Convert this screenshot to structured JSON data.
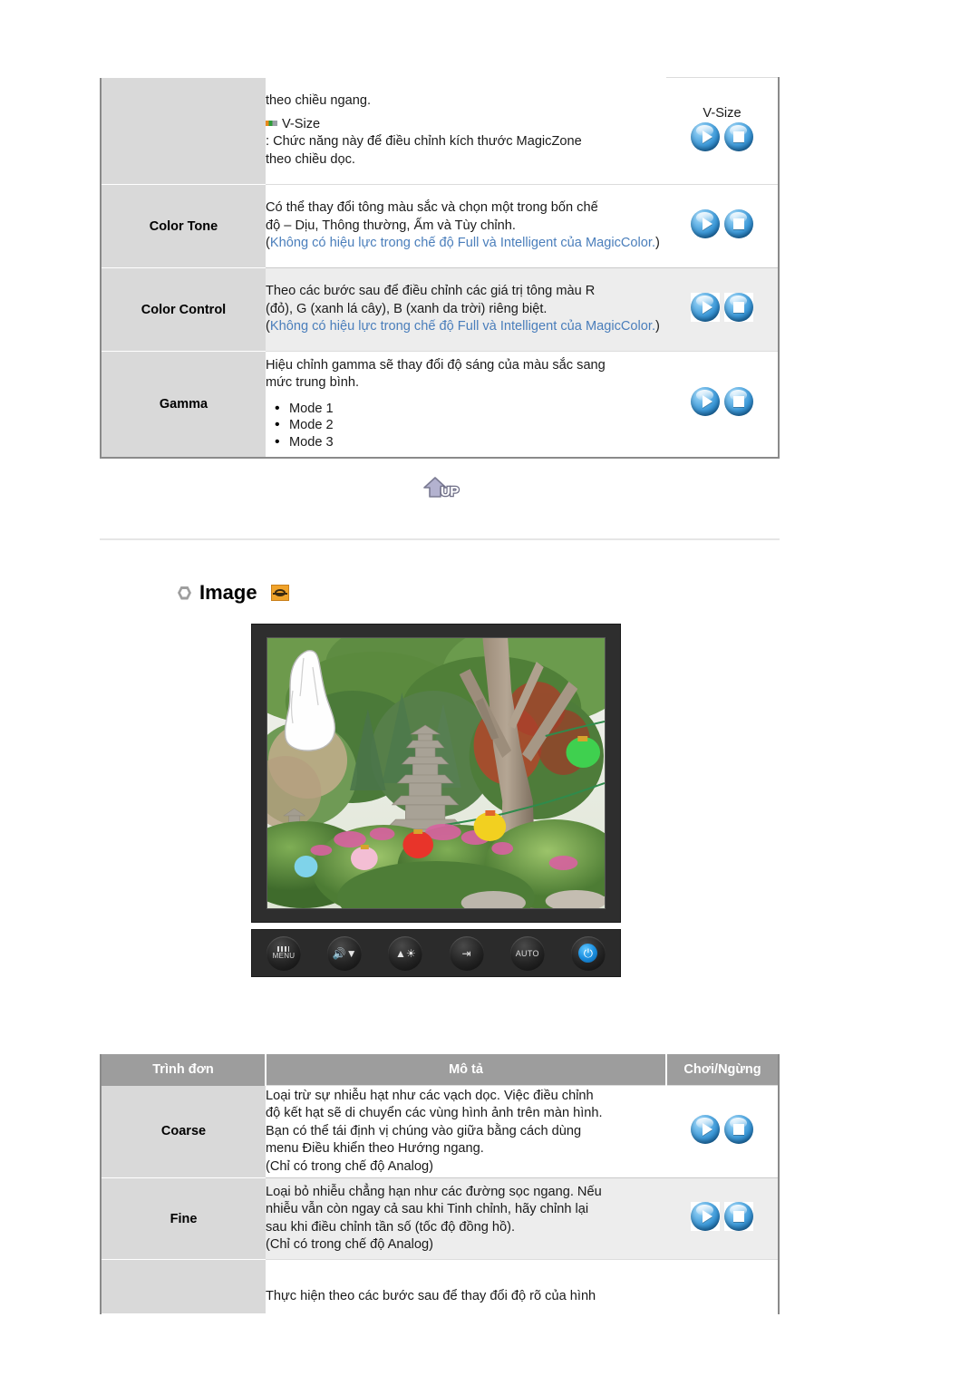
{
  "top_table": {
    "rows": [
      {
        "menu": "",
        "desc_lines": [
          "theo chiều ngang.",
          "V-Size",
          ": Chức năng này để điều chỉnh kích thước MagicZone",
          "theo chiều dọc."
        ],
        "play_label": "V-Size",
        "shade": "white"
      },
      {
        "menu": "Color Tone",
        "desc_lines": [
          "Có thể thay đổi tông màu sắc và chọn một trong bốn chế",
          "độ – Dịu, Thông thường, Ấm và Tùy chỉnh."
        ],
        "note_open": "(",
        "note_blue": "Không có hiệu lực trong chế độ Full và Intelligent của MagicColor.",
        "note_close": ")",
        "play_label": "",
        "shade": "white"
      },
      {
        "menu": "Color Control",
        "desc_lines": [
          "Theo các bước sau để điều chỉnh các giá trị tông màu R",
          "(đỏ), G (xanh lá cây), B (xanh da trời) riêng biệt."
        ],
        "note_open": "(",
        "note_blue": "Không có hiệu lực trong chế độ Full và Intelligent của MagicColor.",
        "note_close": ")",
        "play_label": "",
        "shade": "gray"
      },
      {
        "menu": "Gamma",
        "desc_lines": [
          "Hiệu chỉnh gamma sẽ thay đổi độ sáng của màu sắc sang",
          "mức trung bình."
        ],
        "modes": [
          "Mode 1",
          "Mode 2",
          "Mode 3"
        ],
        "play_label": "",
        "shade": "white"
      }
    ]
  },
  "up_button": {
    "label": "UP"
  },
  "section": {
    "title": "Image",
    "bullet_icon": "hexagon-bullet-icon",
    "badge_icon": "image-badge-icon"
  },
  "monitor": {
    "buttons": [
      {
        "name": "menu-button",
        "label": "MENU"
      },
      {
        "name": "volume-down-button",
        "label": ""
      },
      {
        "name": "brightness-button",
        "label": ""
      },
      {
        "name": "source-button",
        "label": ""
      },
      {
        "name": "auto-button",
        "label": "AUTO"
      },
      {
        "name": "power-button",
        "label": ""
      }
    ]
  },
  "bottom_table": {
    "headers": [
      "Trình đơn",
      "Mô tả",
      "Chơi/Ngừng"
    ],
    "rows": [
      {
        "menu": "Coarse",
        "desc_lines": [
          "Loại trừ sự nhiễu hạt như các vạch dọc. Việc điều chỉnh",
          "độ kết hạt sẽ di chuyển các vùng hình ảnh trên màn hình.",
          "Bạn có thể tái định vị chúng vào giữa bằng cách dùng",
          "menu Điều khiển theo Hướng ngang.",
          "(Chỉ có trong chế độ Analog)"
        ],
        "shade": "white"
      },
      {
        "menu": "Fine",
        "desc_lines": [
          "Loại bỏ nhiễu chẳng hạn như các đường sọc ngang. Nếu",
          "nhiễu vẫn còn ngay cả sau khi Tinh chỉnh, hãy chỉnh lại",
          "sau khi điều chỉnh tần số (tốc độ đồng hồ).",
          "(Chỉ có trong chế độ Analog)"
        ],
        "shade": "gray"
      },
      {
        "menu": "",
        "desc_lines": [
          "Thực hiện theo các bước sau để thay đổi độ rõ của hình"
        ],
        "shade": "white"
      }
    ]
  },
  "colors": {
    "note_blue": "#4a7ebb",
    "header_gray": "#9d9d9d",
    "menu_cell_gray": "#d9d9d9",
    "row_gray": "#ededed",
    "orb_blue": "#3f9ad8",
    "badge_orange": "#f0a32a"
  }
}
